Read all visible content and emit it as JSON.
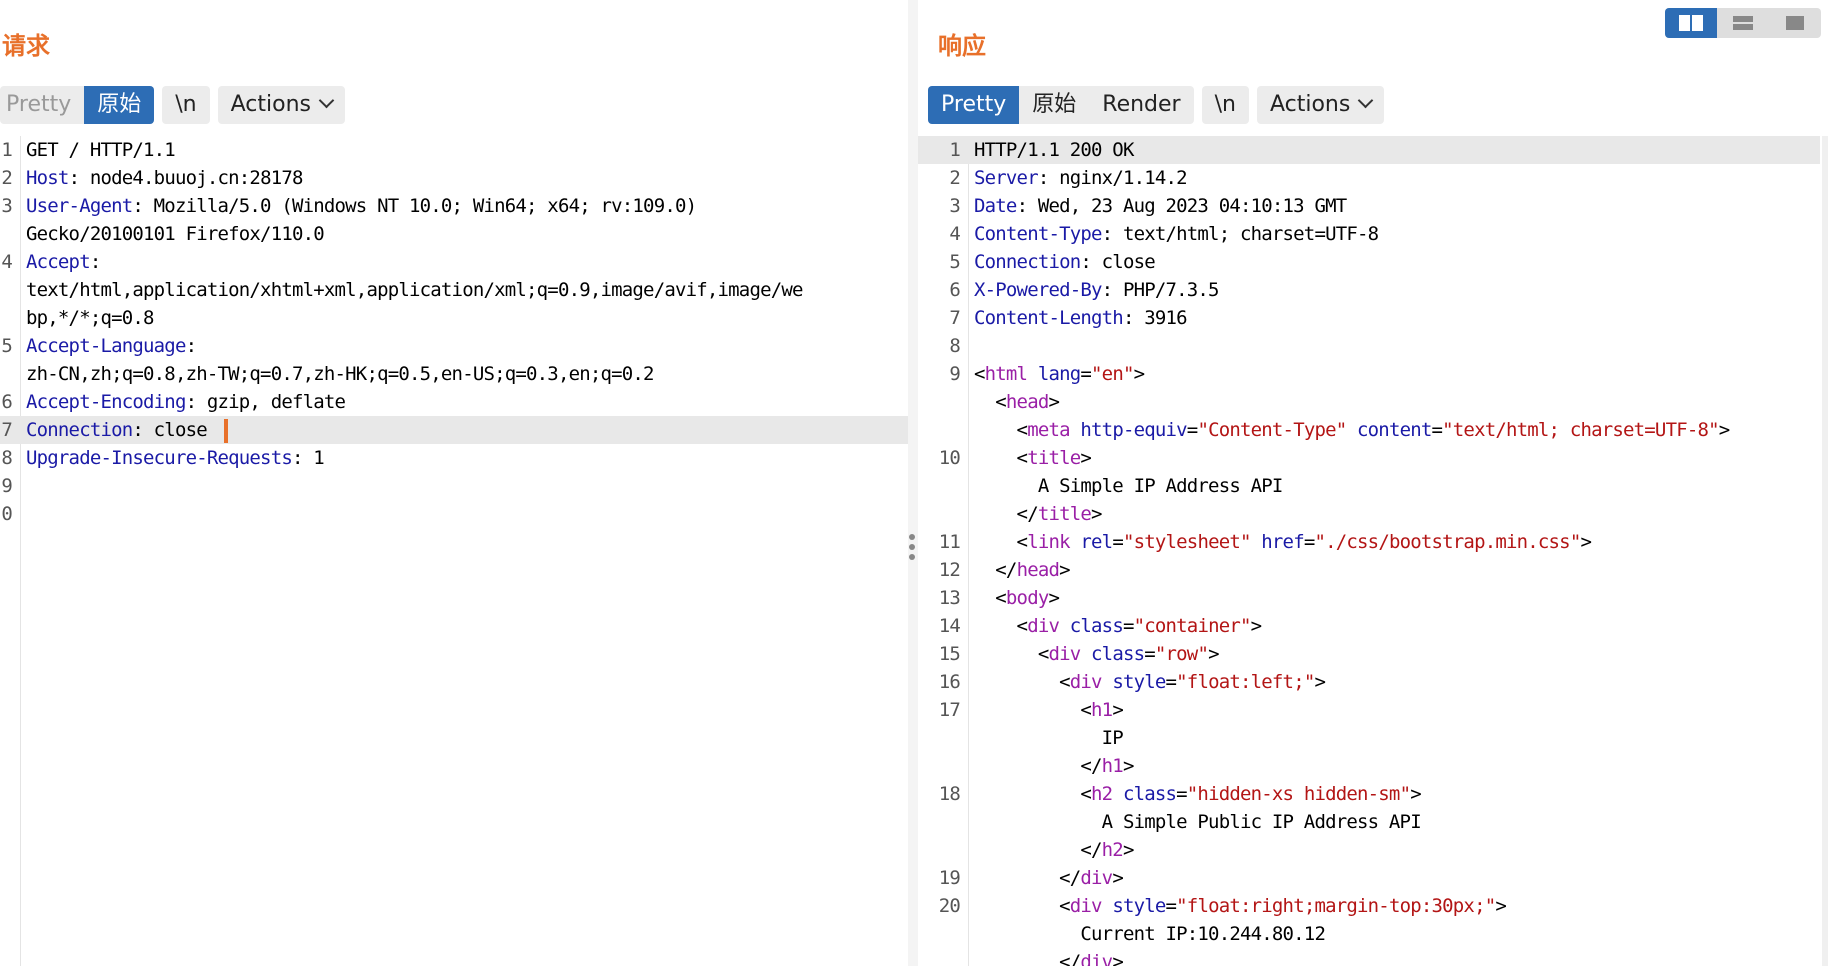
{
  "request": {
    "title": "请求",
    "tabs": [
      "Pretty",
      "原始"
    ],
    "active_tab": "原始",
    "newline_toggle": "\\n",
    "actions_label": "Actions",
    "lines": [
      {
        "n": "1",
        "parts": [
          [
            "",
            "GET / HTTP/1.1"
          ]
        ]
      },
      {
        "n": "2",
        "parts": [
          [
            "k",
            "Host"
          ],
          [
            "",
            ": node4.buuoj.cn:28178"
          ]
        ]
      },
      {
        "n": "3",
        "parts": [
          [
            "k",
            "User-Agent"
          ],
          [
            "",
            ": Mozilla/5.0 (Windows NT 10.0; Win64; x64; rv:109.0)"
          ]
        ]
      },
      {
        "n": "",
        "parts": [
          [
            "",
            "Gecko/20100101 Firefox/110.0"
          ]
        ]
      },
      {
        "n": "4",
        "parts": [
          [
            "k",
            "Accept"
          ],
          [
            "",
            ":"
          ]
        ]
      },
      {
        "n": "",
        "parts": [
          [
            "",
            "text/html,application/xhtml+xml,application/xml;q=0.9,image/avif,image/we"
          ]
        ]
      },
      {
        "n": "",
        "parts": [
          [
            "",
            "bp,*/*;q=0.8"
          ]
        ]
      },
      {
        "n": "5",
        "parts": [
          [
            "k",
            "Accept-Language"
          ],
          [
            "",
            ":"
          ]
        ]
      },
      {
        "n": "",
        "parts": [
          [
            "",
            "zh-CN,zh;q=0.8,zh-TW;q=0.7,zh-HK;q=0.5,en-US;q=0.3,en;q=0.2"
          ]
        ]
      },
      {
        "n": "6",
        "parts": [
          [
            "k",
            "Accept-Encoding"
          ],
          [
            "",
            ": gzip, deflate"
          ]
        ]
      },
      {
        "n": "7",
        "parts": [
          [
            "k",
            "Connection"
          ],
          [
            "",
            ": close "
          ]
        ],
        "hl": true,
        "caret": true
      },
      {
        "n": "8",
        "parts": [
          [
            "k",
            "Upgrade-Insecure-Requests"
          ],
          [
            "",
            ": 1"
          ]
        ]
      },
      {
        "n": "9",
        "parts": []
      },
      {
        "n": "0",
        "parts": []
      }
    ]
  },
  "response": {
    "title": "响应",
    "tabs": [
      "Pretty",
      "原始",
      "Render"
    ],
    "active_tab": "Pretty",
    "newline_toggle": "\\n",
    "actions_label": "Actions",
    "lines": [
      {
        "n": "1",
        "parts": [
          [
            "",
            "HTTP/1.1 200 OK"
          ]
        ],
        "hl": true
      },
      {
        "n": "2",
        "parts": [
          [
            "k",
            "Server"
          ],
          [
            "",
            ": nginx/1.14.2"
          ]
        ]
      },
      {
        "n": "3",
        "parts": [
          [
            "k",
            "Date"
          ],
          [
            "",
            ": Wed, 23 Aug 2023 04:10:13 GMT"
          ]
        ]
      },
      {
        "n": "4",
        "parts": [
          [
            "k",
            "Content-Type"
          ],
          [
            "",
            ": text/html; charset=UTF-8"
          ]
        ]
      },
      {
        "n": "5",
        "parts": [
          [
            "k",
            "Connection"
          ],
          [
            "",
            ": close"
          ]
        ]
      },
      {
        "n": "6",
        "parts": [
          [
            "k",
            "X-Powered-By"
          ],
          [
            "",
            ": PHP/7.3.5"
          ]
        ]
      },
      {
        "n": "7",
        "parts": [
          [
            "k",
            "Content-Length"
          ],
          [
            "",
            ": 3916"
          ]
        ]
      },
      {
        "n": "8",
        "parts": []
      },
      {
        "n": "9",
        "parts": [
          [
            "",
            "<"
          ],
          [
            "t",
            "html"
          ],
          [
            "",
            ""
          ],
          [
            "a",
            " lang"
          ],
          [
            "",
            "="
          ],
          [
            "v",
            "\"en\""
          ],
          [
            "",
            ">"
          ]
        ]
      },
      {
        "n": "",
        "parts": [
          [
            "",
            "  <"
          ],
          [
            "t",
            "head"
          ],
          [
            "",
            ">"
          ]
        ]
      },
      {
        "n": "",
        "parts": [
          [
            "",
            "    <"
          ],
          [
            "t",
            "meta"
          ],
          [
            "a",
            " http-equiv"
          ],
          [
            "",
            "="
          ],
          [
            "v",
            "\"Content-Type\""
          ],
          [
            "a",
            " content"
          ],
          [
            "",
            "="
          ],
          [
            "v",
            "\"text/html; charset=UTF-8\""
          ],
          [
            "",
            ">"
          ]
        ]
      },
      {
        "n": "10",
        "parts": [
          [
            "",
            "    <"
          ],
          [
            "t",
            "title"
          ],
          [
            "",
            ">"
          ]
        ]
      },
      {
        "n": "",
        "parts": [
          [
            "",
            "      A Simple IP Address API"
          ]
        ]
      },
      {
        "n": "",
        "parts": [
          [
            "",
            "    </"
          ],
          [
            "t",
            "title"
          ],
          [
            "",
            ">"
          ]
        ]
      },
      {
        "n": "11",
        "parts": [
          [
            "",
            "    <"
          ],
          [
            "t",
            "link"
          ],
          [
            "a",
            " rel"
          ],
          [
            "",
            "="
          ],
          [
            "v",
            "\"stylesheet\""
          ],
          [
            "a",
            " href"
          ],
          [
            "",
            "="
          ],
          [
            "v",
            "\"./css/bootstrap.min.css\""
          ],
          [
            "",
            ">"
          ]
        ]
      },
      {
        "n": "12",
        "parts": [
          [
            "",
            "  </"
          ],
          [
            "t",
            "head"
          ],
          [
            "",
            ">"
          ]
        ]
      },
      {
        "n": "13",
        "parts": [
          [
            "",
            "  <"
          ],
          [
            "t",
            "body"
          ],
          [
            "",
            ">"
          ]
        ]
      },
      {
        "n": "14",
        "parts": [
          [
            "",
            "    <"
          ],
          [
            "t",
            "div"
          ],
          [
            "a",
            " class"
          ],
          [
            "",
            "="
          ],
          [
            "v",
            "\"container\""
          ],
          [
            "",
            ">"
          ]
        ]
      },
      {
        "n": "15",
        "parts": [
          [
            "",
            "      <"
          ],
          [
            "t",
            "div"
          ],
          [
            "a",
            " class"
          ],
          [
            "",
            "="
          ],
          [
            "v",
            "\"row\""
          ],
          [
            "",
            ">"
          ]
        ]
      },
      {
        "n": "16",
        "parts": [
          [
            "",
            "        <"
          ],
          [
            "t",
            "div"
          ],
          [
            "a",
            " style"
          ],
          [
            "",
            "="
          ],
          [
            "v",
            "\"float:left;\""
          ],
          [
            "",
            ">"
          ]
        ]
      },
      {
        "n": "17",
        "parts": [
          [
            "",
            "          <"
          ],
          [
            "t",
            "h1"
          ],
          [
            "",
            ">"
          ]
        ]
      },
      {
        "n": "",
        "parts": [
          [
            "",
            "            IP"
          ]
        ]
      },
      {
        "n": "",
        "parts": [
          [
            "",
            "          </"
          ],
          [
            "t",
            "h1"
          ],
          [
            "",
            ">"
          ]
        ]
      },
      {
        "n": "18",
        "parts": [
          [
            "",
            "          <"
          ],
          [
            "t",
            "h2"
          ],
          [
            "a",
            " class"
          ],
          [
            "",
            "="
          ],
          [
            "v",
            "\"hidden-xs hidden-sm\""
          ],
          [
            "",
            ">"
          ]
        ]
      },
      {
        "n": "",
        "parts": [
          [
            "",
            "            A Simple Public IP Address API"
          ]
        ]
      },
      {
        "n": "",
        "parts": [
          [
            "",
            "          </"
          ],
          [
            "t",
            "h2"
          ],
          [
            "",
            ">"
          ]
        ]
      },
      {
        "n": "19",
        "parts": [
          [
            "",
            "        </"
          ],
          [
            "t",
            "div"
          ],
          [
            "",
            ">"
          ]
        ]
      },
      {
        "n": "20",
        "parts": [
          [
            "",
            "        <"
          ],
          [
            "t",
            "div"
          ],
          [
            "a",
            " style"
          ],
          [
            "",
            "="
          ],
          [
            "v",
            "\"float:right;margin-top:30px;\""
          ],
          [
            "",
            ">"
          ]
        ]
      },
      {
        "n": "",
        "parts": [
          [
            "",
            "          Current IP:10.244.80.12"
          ]
        ]
      },
      {
        "n": "",
        "parts": [
          [
            "",
            "        </"
          ],
          [
            "t",
            "div"
          ],
          [
            "",
            ">"
          ]
        ]
      }
    ]
  },
  "layout_buttons": [
    {
      "name": "side-by-side-layout-icon",
      "active": true
    },
    {
      "name": "stacked-layout-icon",
      "active": false
    },
    {
      "name": "single-pane-layout-icon",
      "active": false
    }
  ],
  "colors": {
    "accent": "#e8702a",
    "active_tab": "#2d6db5",
    "header_key": "#1a1aa6",
    "tag": "#9a1fa6",
    "attr_value": "#b31515"
  }
}
